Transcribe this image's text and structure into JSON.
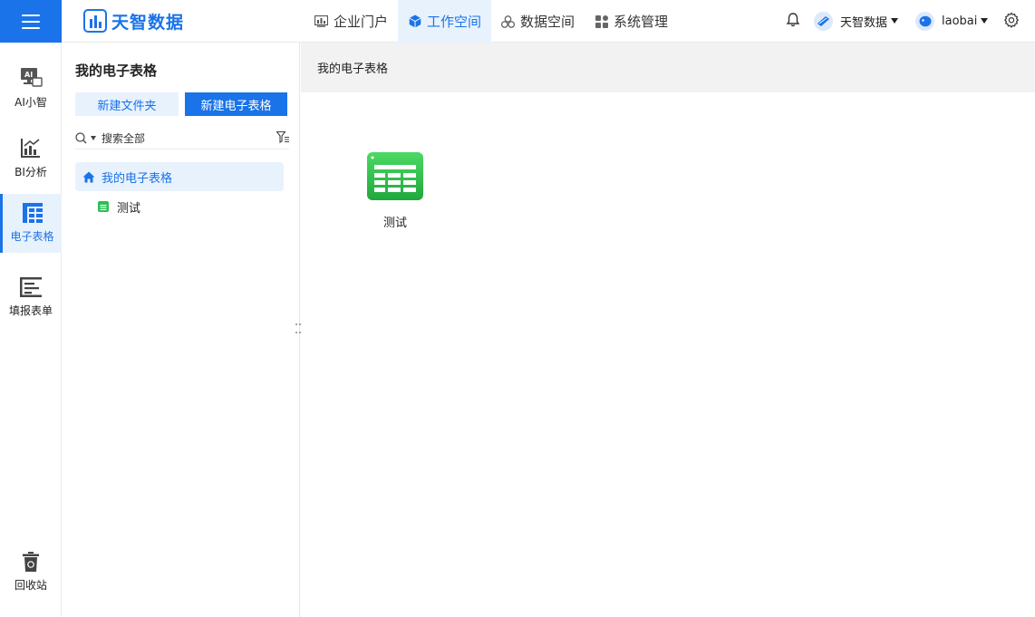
{
  "app": {
    "name": "天智数据",
    "brand_color": "#1a73e8"
  },
  "topnav": {
    "items": [
      {
        "label": "企业门户",
        "icon": "dashboard-icon"
      },
      {
        "label": "工作空间",
        "icon": "cube-icon",
        "active": true
      },
      {
        "label": "数据空间",
        "icon": "data-cluster-icon"
      },
      {
        "label": "系统管理",
        "icon": "modules-icon"
      }
    ],
    "org_label": "天智数据",
    "user_label": "laobai"
  },
  "sidebar": {
    "items": [
      {
        "label": "AI小智",
        "icon": "ai-monitor-icon"
      },
      {
        "label": "BI分析",
        "icon": "bar-chart-icon"
      },
      {
        "label": "电子表格",
        "icon": "spreadsheet-icon",
        "active": true
      },
      {
        "label": "填报表单",
        "icon": "form-icon"
      }
    ],
    "bottom_item": {
      "label": "回收站",
      "icon": "recycle-bin-icon"
    }
  },
  "tree_panel": {
    "title": "我的电子表格",
    "new_folder_label": "新建文件夹",
    "new_sheet_label": "新建电子表格",
    "search_placeholder": "搜索全部",
    "root_label": "我的电子表格",
    "children": [
      {
        "label": "测试",
        "icon": "sheet-file-icon"
      }
    ]
  },
  "content": {
    "breadcrumb": "我的电子表格",
    "files": [
      {
        "label": "测试",
        "icon": "spreadsheet-file-icon"
      }
    ]
  }
}
